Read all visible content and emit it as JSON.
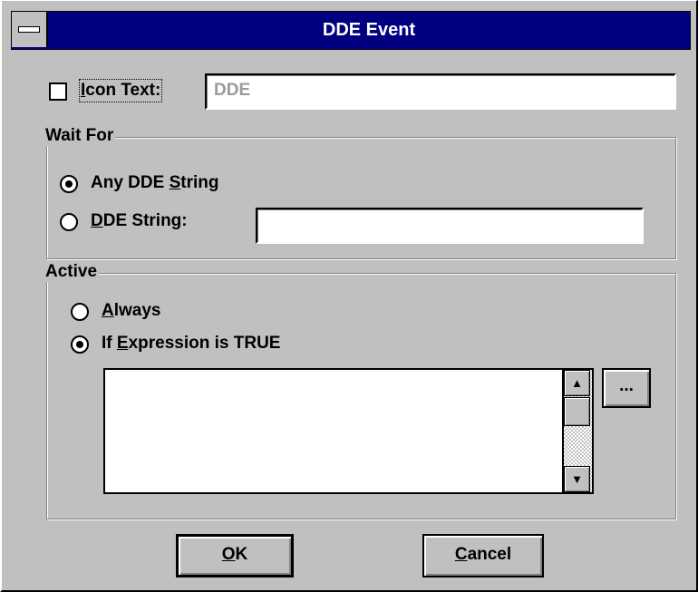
{
  "window": {
    "title": "DDE Event"
  },
  "icon_text": {
    "checked": false,
    "label_prefix": "",
    "label_accel": "I",
    "label_rest": "con Text:",
    "value": "DDE"
  },
  "wait_for": {
    "group_label": "Wait For",
    "options": [
      {
        "pre": "Any DDE ",
        "accel": "S",
        "post": "tring",
        "selected": true
      },
      {
        "pre": "",
        "accel": "D",
        "post": "DE String:",
        "selected": false
      }
    ],
    "dde_string_value": ""
  },
  "active": {
    "group_label": "Active",
    "options": [
      {
        "pre": "",
        "accel": "A",
        "post": "lways",
        "selected": false
      },
      {
        "pre": "If ",
        "accel": "E",
        "post": "xpression is TRUE",
        "selected": true
      }
    ],
    "expression_value": "",
    "browse_label": "...",
    "scroll_up": "▲",
    "scroll_down": "▼"
  },
  "buttons": {
    "ok": {
      "accel": "O",
      "rest": "K"
    },
    "cancel": {
      "accel": "C",
      "rest": "ancel"
    }
  }
}
